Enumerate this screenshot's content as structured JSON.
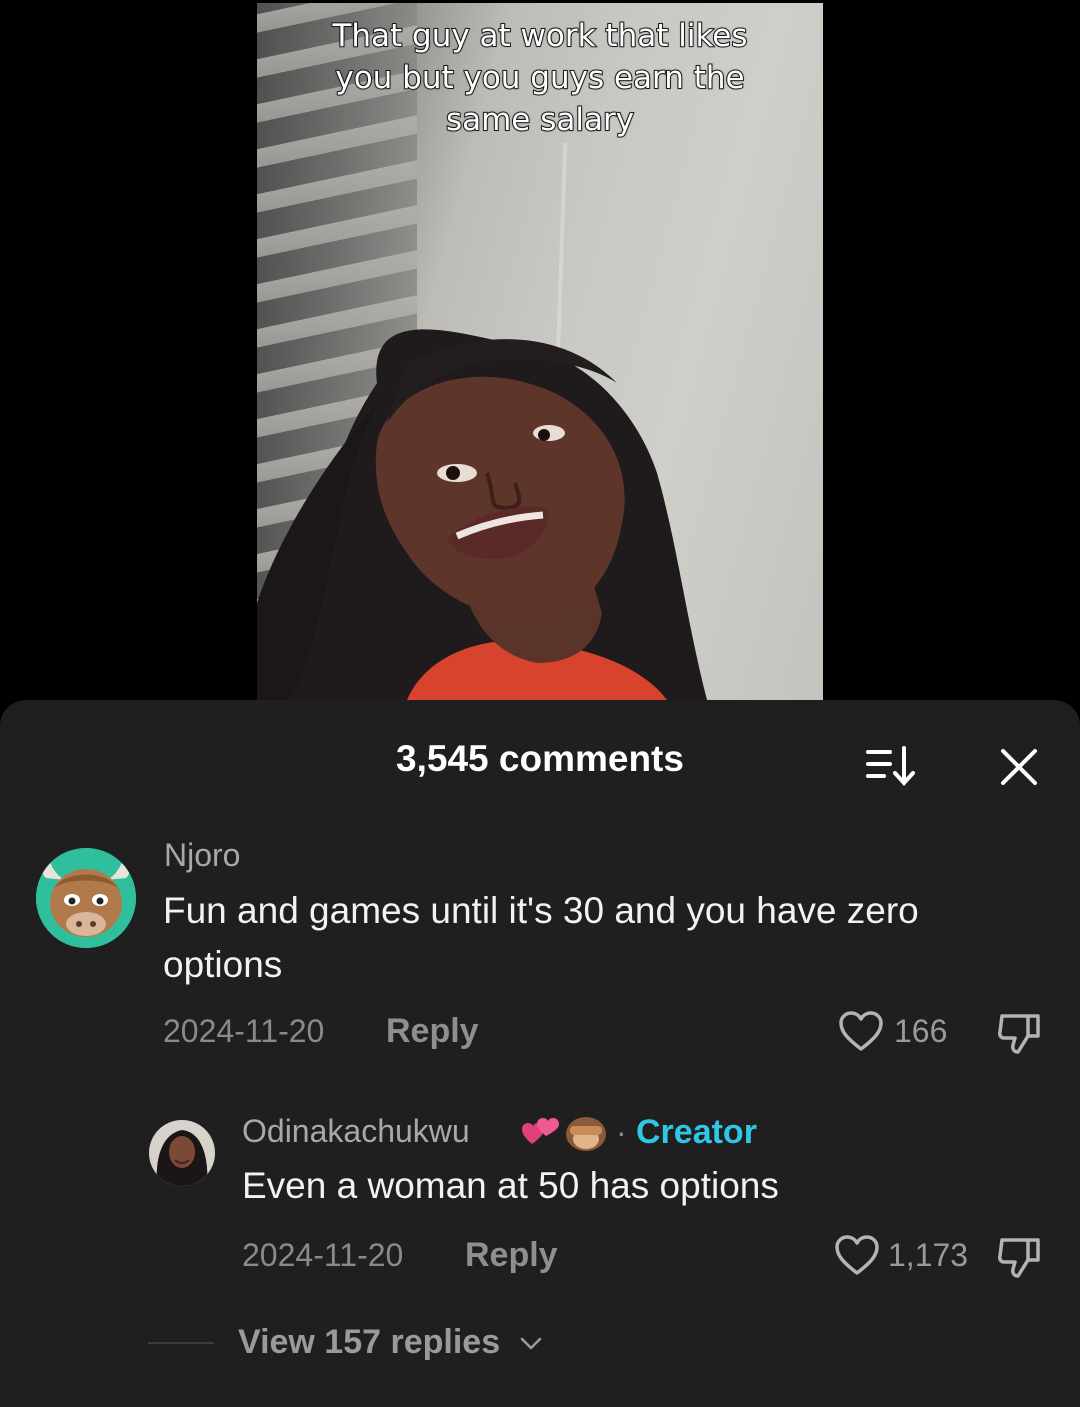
{
  "video": {
    "caption_lines": [
      "That guy at work that likes",
      "you but you guys earn the",
      "same salary"
    ]
  },
  "sheet": {
    "title": "3,545 comments"
  },
  "comments": [
    {
      "username": "Njoro",
      "text_lines": [
        "Fun and games until it's 30 and you have zero",
        "options"
      ],
      "date": "2024-11-20",
      "reply_label": "Reply",
      "likes": "166"
    },
    {
      "username": "Odinakachukwu",
      "badge_separator": "·",
      "badge": "Creator",
      "text": "Even a woman at 50 has options",
      "date": "2024-11-20",
      "reply_label": "Reply",
      "likes": "1,173"
    }
  ],
  "view_replies": "View 157 replies",
  "colors": {
    "sheet_bg": "#1f1f1f",
    "creator_accent": "#30c6e6"
  }
}
